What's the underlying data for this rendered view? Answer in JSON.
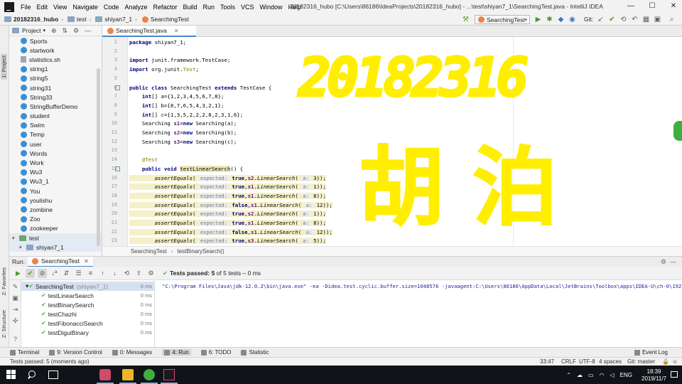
{
  "window": {
    "title": "20182316_hubo [C:\\Users\\86186\\IdeaProjects\\20182316_hubo] - ...\\test\\shiyan7_1\\SearchingTest.java - IntelliJ IDEA",
    "minimize": "—",
    "maximize": "☐",
    "close": "✕"
  },
  "menu": [
    "File",
    "Edit",
    "View",
    "Navigate",
    "Code",
    "Analyze",
    "Refactor",
    "Build",
    "Run",
    "Tools",
    "VCS",
    "Window",
    "Help"
  ],
  "navbar": {
    "project": "20182316_hubo",
    "folder1": "test",
    "folder2": "shiyan7_1",
    "file": "SearchingTest",
    "run_config": "SearchingTest",
    "git_label": "Git:"
  },
  "left_strip": {
    "project_tab": "1: Project",
    "favorites_tab": "2: Favorites",
    "structure_tab": "Z: Structure"
  },
  "project_panel": {
    "title": "Project",
    "tree": [
      {
        "label": "Sports",
        "type": "class"
      },
      {
        "label": "startwork",
        "type": "class"
      },
      {
        "label": "statistics.sh",
        "type": "file"
      },
      {
        "label": "string1",
        "type": "class"
      },
      {
        "label": "string5",
        "type": "class"
      },
      {
        "label": "string31",
        "type": "class"
      },
      {
        "label": "String33",
        "type": "class"
      },
      {
        "label": "StringBufferDemo",
        "type": "class"
      },
      {
        "label": "student",
        "type": "class"
      },
      {
        "label": "Swim",
        "type": "class"
      },
      {
        "label": "Temp",
        "type": "class"
      },
      {
        "label": "user",
        "type": "class"
      },
      {
        "label": "Words",
        "type": "class"
      },
      {
        "label": "Work",
        "type": "class"
      },
      {
        "label": "Wu3",
        "type": "class"
      },
      {
        "label": "Wu3_1",
        "type": "class"
      },
      {
        "label": "You",
        "type": "class"
      },
      {
        "label": "youlishu",
        "type": "class"
      },
      {
        "label": "zombine",
        "type": "class"
      },
      {
        "label": "Zoo",
        "type": "class"
      },
      {
        "label": "zookeeper",
        "type": "class"
      },
      {
        "label": "test",
        "type": "folder-green",
        "expand": "▾"
      },
      {
        "label": "shiyan7_1",
        "type": "folder",
        "expand": "▾"
      }
    ]
  },
  "editor": {
    "tab_label": "SearchingTest.java",
    "line_numbers": [
      "1",
      "2",
      "3",
      "4",
      "5",
      "6",
      "7",
      "8",
      "9",
      "10",
      "11",
      "12",
      "13",
      "14",
      "15",
      "16",
      "17",
      "18",
      "19",
      "20",
      "21",
      "22",
      "23"
    ],
    "breadcrumb_class": "SearchingTest",
    "breadcrumb_method": "testBinarySearch()",
    "breadcrumb_sep": "›"
  },
  "code": {
    "package_kw": "package",
    "package_name": " shiyan7_1;",
    "import_kw": "import",
    "import1": " junit.framework.TestCase;",
    "import2_a": " org.junit.",
    "import2_b": "Test",
    "import2_c": ";",
    "class_kw": "public class",
    "class_rest": " SearchingTest ",
    "extends_kw": "extends",
    "class_end": " TestCase {",
    "int_kw": "int",
    "arr_a": "[] a={1,2,3,4,5,6,7,8};",
    "arr_b": "[] b={8,7,6,5,4,3,2,1};",
    "arr_c": "[] c={1,3,5,2,2,2,8,2,3,1,6};",
    "s_type": "Searching ",
    "new_kw": "new",
    "s1": "s1",
    "s2": "s2",
    "s3": "s3",
    "s1_rest": " Searching(a);",
    "s2_rest": " Searching(b);",
    "s3_rest": " Searching(c);",
    "eq": "=",
    "annotation": "@Test",
    "method_kw": "public void",
    "method_name": "testLinearSearch",
    "method_end": "() {",
    "assert_name": "assertEquals",
    "hint_expected": "expected:",
    "hint_a": "a:",
    "true_kw": "true",
    "false_kw": "false",
    "linear": "LinearSearch",
    "asserts": [
      {
        "val": "true",
        "obj": "s2",
        "arg": "3"
      },
      {
        "val": "true",
        "obj": "s1",
        "arg": "1"
      },
      {
        "val": "true",
        "obj": "s1",
        "arg": "8"
      },
      {
        "val": "false",
        "obj": "s1",
        "arg": "12"
      },
      {
        "val": "true",
        "obj": "s2",
        "arg": "1"
      },
      {
        "val": "true",
        "obj": "s1",
        "arg": "8"
      },
      {
        "val": "false",
        "obj": "s1",
        "arg": "12"
      },
      {
        "val": "true",
        "obj": "s3",
        "arg": "5"
      }
    ]
  },
  "handwriting": {
    "line1": "20182316",
    "line2": "胡泊"
  },
  "run_panel": {
    "label": "Run:",
    "tab": "SearchingTest",
    "status_prefix": "Tests passed:",
    "status_count": "5",
    "status_suffix": "of 5 tests – 0 ms",
    "tests": [
      {
        "name": "SearchingTest",
        "extra": "(shiyan7_1)",
        "time": "0 ms",
        "root": true
      },
      {
        "name": "testLinearSearch",
        "time": "0 ms"
      },
      {
        "name": "testBinarySearch",
        "time": "0 ms"
      },
      {
        "name": "testChazhi",
        "time": "0 ms"
      },
      {
        "name": "testFibonacciSearch",
        "time": "0 ms"
      },
      {
        "name": "testDiguiBinary",
        "time": "0 ms"
      }
    ],
    "console": "\"C:\\Program Files\\Java\\jdk-12.0.2\\bin\\java.exe\" -ea -Didea.test.cyclic.buffer.size=1048576 -javaagent:C:\\Users\\86186\\AppData\\Local\\JetBrains\\Toolbox\\apps\\IDEA-U\\ch-0\\192.6603.28\\lib\\idea_rt.jar"
  },
  "bottom_tools": [
    "Terminal",
    "9: Version Control",
    "0: Messages",
    "4: Run",
    "6: TODO",
    "Statistic"
  ],
  "event_log": "Event Log",
  "status_bar": {
    "message": "Tests passed: 5 (moments ago)",
    "position": "33:47",
    "line_sep": "CRLF",
    "encoding": "UTF-8",
    "indent": "4 spaces",
    "git": "Git: master"
  },
  "taskbar": {
    "lang": "ENG",
    "time": "18:39",
    "date": "2019/11/7"
  }
}
